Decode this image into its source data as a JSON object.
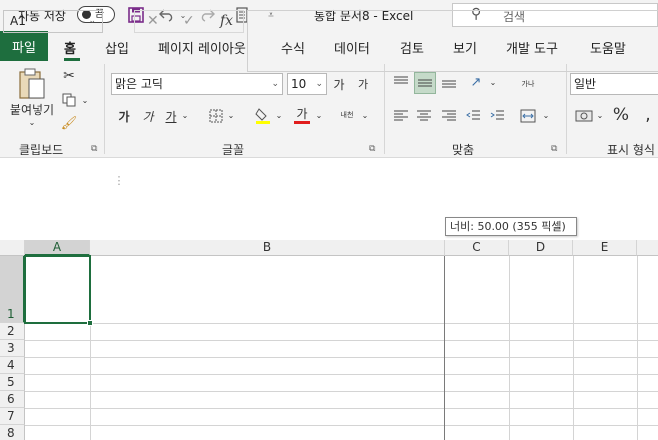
{
  "titlebar": {
    "autosave_label": "자동 저장",
    "autosave_state": "끔",
    "doc_title": "통합 문서8  -  Excel",
    "search_placeholder": "검색"
  },
  "tabs": [
    {
      "label": "파일"
    },
    {
      "label": "홈"
    },
    {
      "label": "삽입"
    },
    {
      "label": "페이지 레이아웃"
    },
    {
      "label": "수식"
    },
    {
      "label": "데이터"
    },
    {
      "label": "검토"
    },
    {
      "label": "보기"
    },
    {
      "label": "개발 도구"
    },
    {
      "label": "도움말"
    }
  ],
  "ribbon": {
    "clipboard": {
      "paste_label": "붙여넣기",
      "group_label": "클립보드"
    },
    "font": {
      "font_name": "맑은 고딕",
      "font_size": "10",
      "grow_label": "가",
      "shrink_label": "가",
      "bold_label": "가",
      "italic_label": "가",
      "underline_label": "가",
      "font_color_label": "가",
      "phonetic_label": "내천",
      "group_label": "글꼴"
    },
    "alignment": {
      "wrap_label": "가나",
      "group_label": "맞춤"
    },
    "number": {
      "format": "일반",
      "percent_label": "%",
      "group_label": "표시 형식"
    }
  },
  "formula_bar": {
    "name_box": "A1",
    "fx_label": "fx",
    "tooltip": "너비: 50.00 (355 픽셀)"
  },
  "grid": {
    "columns": [
      "A",
      "B",
      "C",
      "D",
      "E"
    ],
    "rows": [
      "1",
      "2",
      "3",
      "4",
      "5",
      "6",
      "7",
      "8"
    ],
    "selected_cell": "A1"
  },
  "colors": {
    "accent": "#1e6e3e",
    "ribbon_bg": "#f3f3f3"
  }
}
